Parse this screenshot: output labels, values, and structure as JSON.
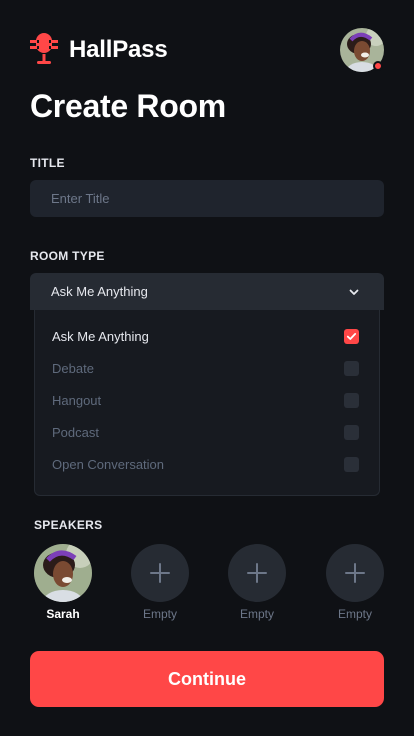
{
  "app": {
    "name": "HallPass"
  },
  "colors": {
    "accent": "#ff4747",
    "background": "#0f1115",
    "surface": "#1f242d",
    "muted": "#6d7789"
  },
  "header": {
    "avatar": "user-avatar",
    "status": "online-dot"
  },
  "page": {
    "title": "Create Room"
  },
  "title_field": {
    "label": "TITLE",
    "placeholder": "Enter Title",
    "value": ""
  },
  "room_type": {
    "label": "ROOM TYPE",
    "selected": "Ask Me Anything",
    "options": [
      {
        "label": "Ask Me Anything",
        "checked": true
      },
      {
        "label": "Debate",
        "checked": false
      },
      {
        "label": "Hangout",
        "checked": false
      },
      {
        "label": "Podcast",
        "checked": false
      },
      {
        "label": "Open Conversation",
        "checked": false
      }
    ]
  },
  "speakers": {
    "label": "SPEAKERS",
    "slots": [
      {
        "name": "Sarah",
        "filled": true,
        "icon": "speaker-avatar"
      },
      {
        "name": "Empty",
        "filled": false,
        "icon": "plus-icon"
      },
      {
        "name": "Empty",
        "filled": false,
        "icon": "plus-icon"
      },
      {
        "name": "Empty",
        "filled": false,
        "icon": "plus-icon"
      }
    ]
  },
  "actions": {
    "continue_label": "Continue"
  }
}
